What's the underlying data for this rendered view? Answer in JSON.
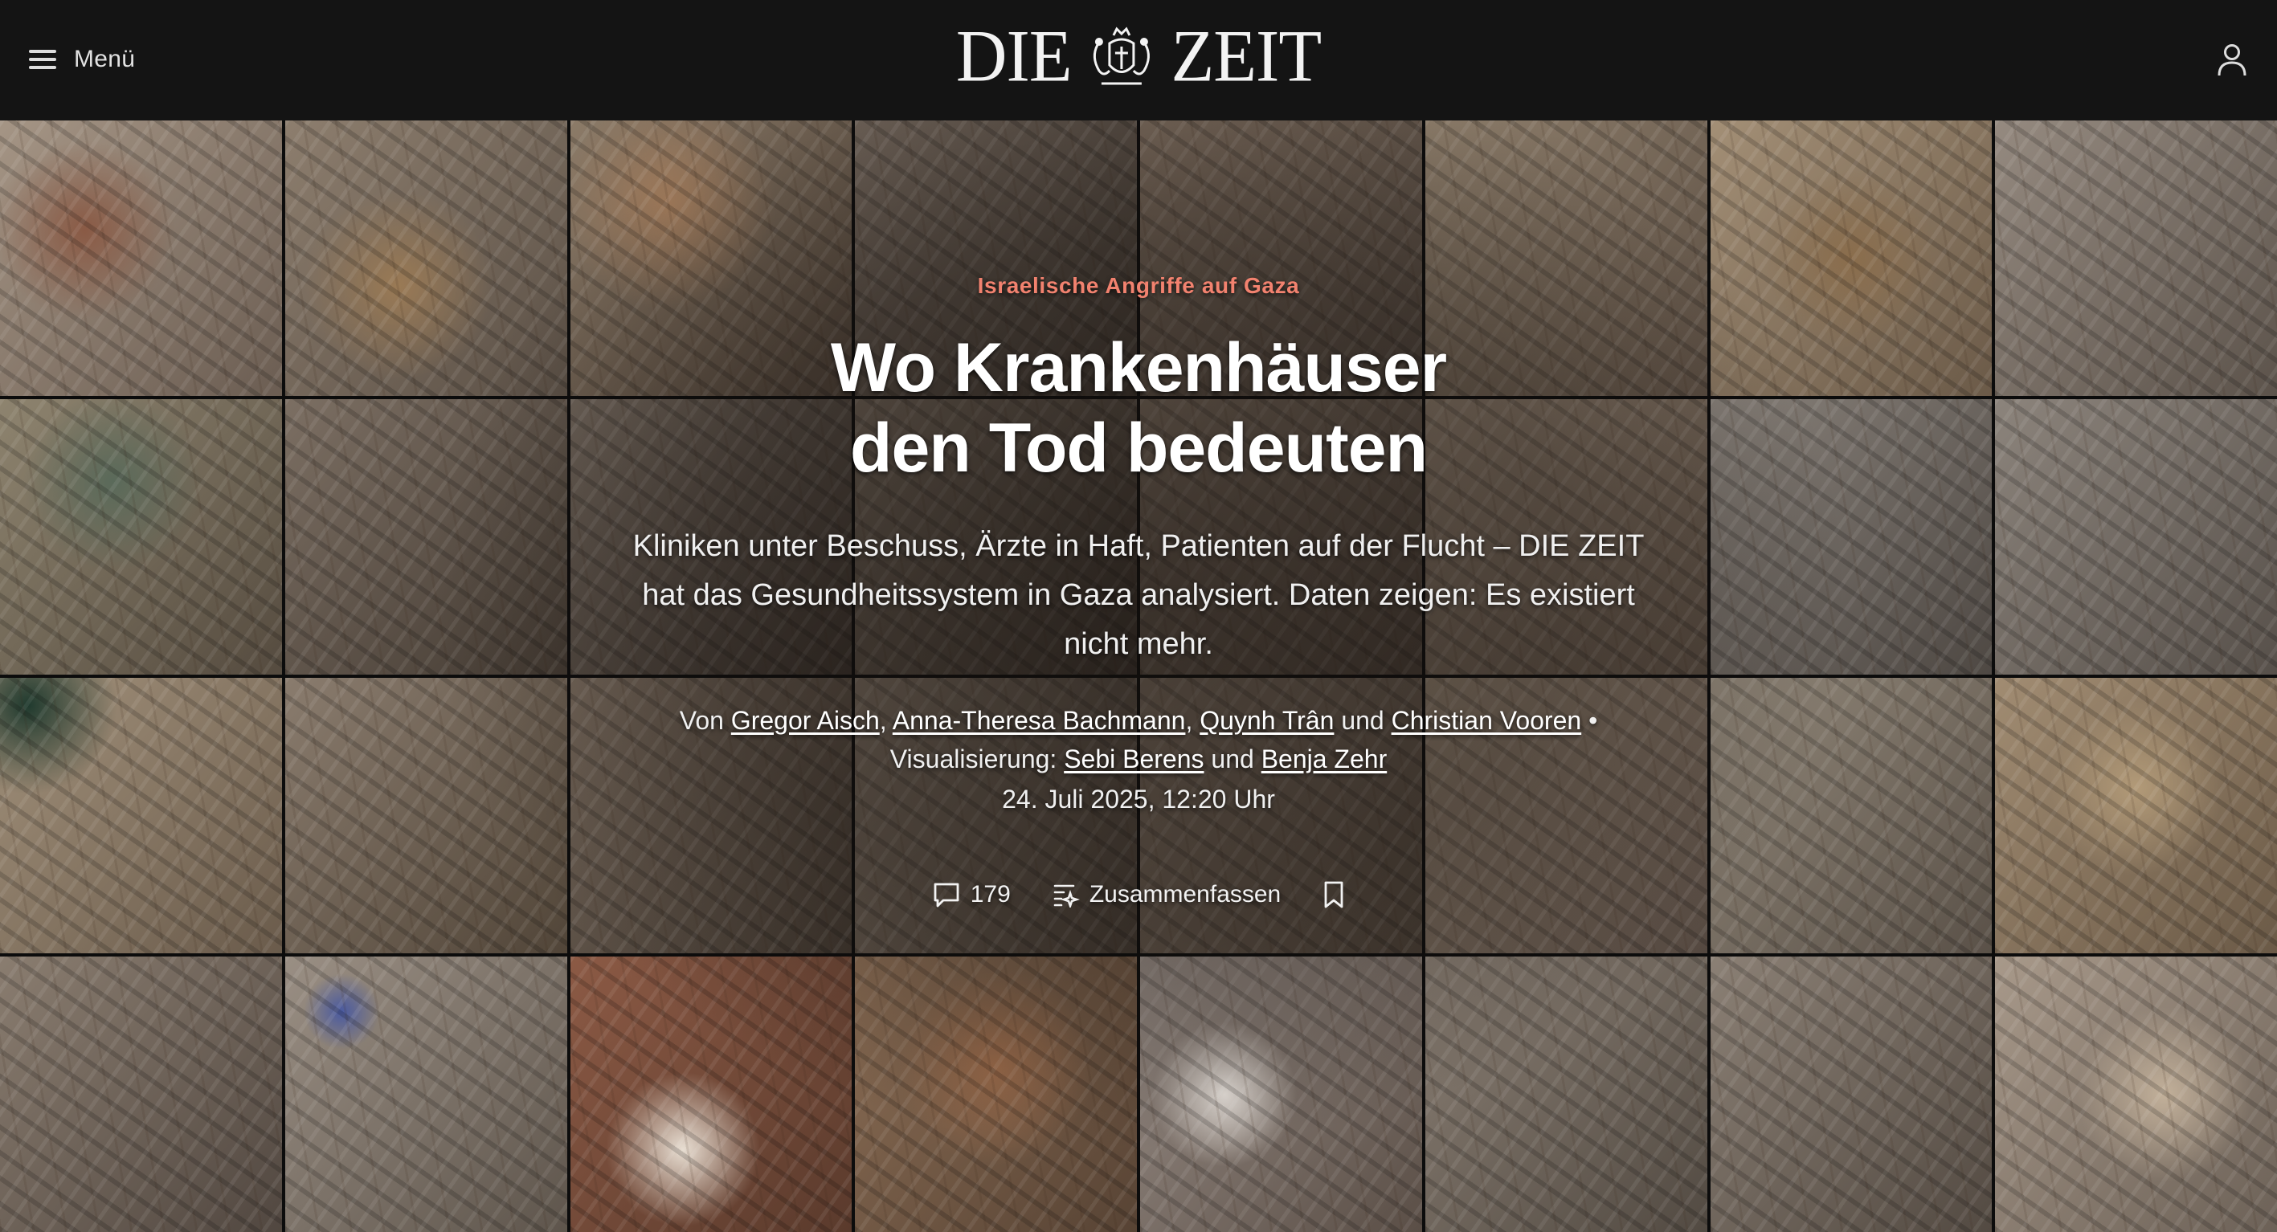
{
  "header": {
    "menu_label": "Menü",
    "logo_left": "DIE",
    "logo_right": "ZEIT",
    "icons": {
      "menu": "hamburger-icon",
      "crest": "crest-icon",
      "account": "user-icon"
    }
  },
  "article": {
    "kicker": "Israelische Angriffe auf Gaza",
    "title_line1": "Wo Krankenhäuser",
    "title_line2": "den Tod bedeuten",
    "lead": "Kliniken unter Beschuss, Ärzte in Haft, Patienten auf der Flucht – DIE ZEIT hat das Gesundheitssystem in Gaza analysiert. Daten zeigen: Es existiert nicht mehr.",
    "byline": {
      "prefix": "Von",
      "authors": [
        "Gregor Aisch",
        "Anna-Theresa Bachmann",
        "Quynh Trân",
        "Christian Vooren"
      ],
      "sep": ",",
      "and": "und",
      "dot": "•",
      "viz_prefix": "Visualisierung:",
      "visualizers": [
        "Sebi Berens",
        "Benja Zehr"
      ]
    },
    "date": "24. Juli 2025, 12:20 Uhr",
    "actions": {
      "comments_count": "179",
      "summarize_label": "Zusammenfassen",
      "icons": {
        "comments": "comment-icon",
        "summarize": "summarize-icon",
        "bookmark": "bookmark-icon"
      }
    }
  },
  "colors": {
    "header_bg": "#141414",
    "kicker": "#f2826f",
    "text": "#ffffff"
  }
}
